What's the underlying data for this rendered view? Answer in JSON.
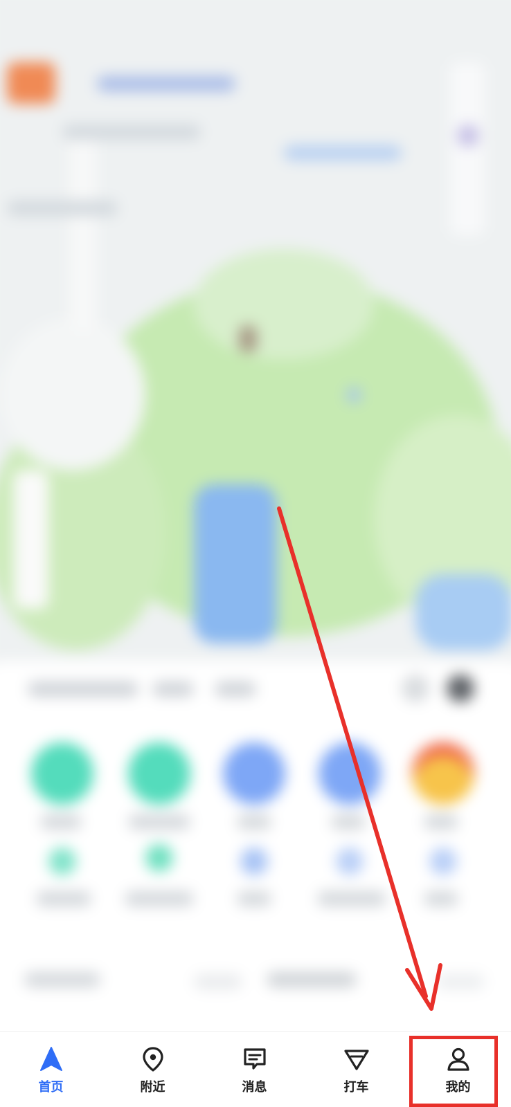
{
  "tabbar": {
    "active_color": "#2f6df6",
    "items": [
      {
        "key": "home",
        "label": "首页",
        "icon": "navigation-arrow-icon",
        "active": true
      },
      {
        "key": "nearby",
        "label": "附近",
        "icon": "location-pin-icon",
        "active": false
      },
      {
        "key": "messages",
        "label": "消息",
        "icon": "message-icon",
        "active": false
      },
      {
        "key": "taxi",
        "label": "打车",
        "icon": "taxi-icon",
        "active": false
      },
      {
        "key": "mine",
        "label": "我的",
        "icon": "profile-icon",
        "active": false
      }
    ]
  },
  "annotation": {
    "color": "#e8302a",
    "highlight_target": "我的"
  },
  "map": {
    "green": "#bfe8a8",
    "water": "#7fb3f0"
  }
}
